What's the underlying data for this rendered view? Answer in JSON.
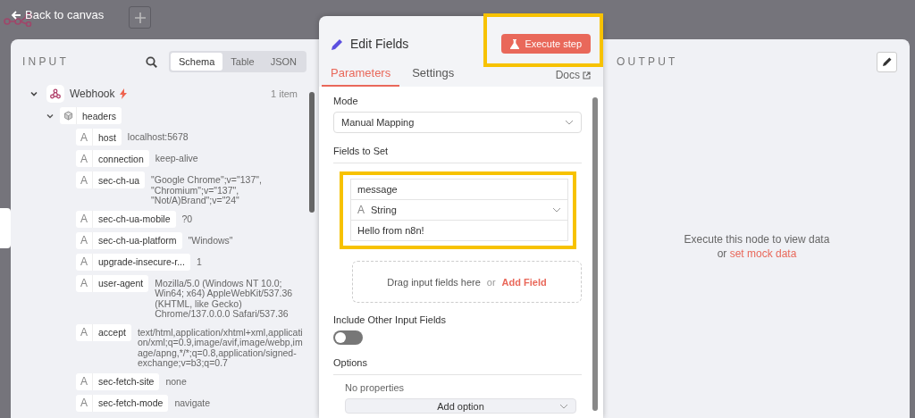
{
  "top_bar": {
    "back_label": "Back to canvas"
  },
  "input": {
    "title": "INPUT",
    "view_tabs": [
      {
        "label": "Schema",
        "selected": true
      },
      {
        "label": "Table",
        "selected": false
      },
      {
        "label": "JSON",
        "selected": false
      }
    ],
    "node": {
      "name": "Webhook",
      "count": "1 item",
      "expanded": true,
      "children": [
        {
          "name": "headers",
          "expanded": true,
          "children": [
            {
              "type_icon": "A",
              "name": "host",
              "value": "localhost:5678"
            },
            {
              "type_icon": "A",
              "name": "connection",
              "value": "keep-alive"
            },
            {
              "type_icon": "A",
              "name": "sec-ch-ua",
              "value": "\"Google Chrome\";v=\"137\", \"Chromium\";v=\"137\", \"Not/A)Brand\";v=\"24\""
            },
            {
              "type_icon": "A",
              "name": "sec-ch-ua-mobile",
              "value": "?0"
            },
            {
              "type_icon": "A",
              "name": "sec-ch-ua-platform",
              "value": "\"Windows\""
            },
            {
              "type_icon": "A",
              "name": "upgrade-insecure-r...",
              "value": "1"
            },
            {
              "type_icon": "A",
              "name": "user-agent",
              "value": "Mozilla/5.0 (Windows NT 10.0; Win64; x64) AppleWebKit/537.36 (KHTML, like Gecko) Chrome/137.0.0.0 Safari/537.36"
            },
            {
              "type_icon": "A",
              "name": "accept",
              "value": "text/html,application/xhtml+xml,application/xml;q=0.9,image/avif,image/webp,image/apng,*/*;q=0.8,application/signed-exchange;v=b3;q=0.7"
            },
            {
              "type_icon": "A",
              "name": "sec-fetch-site",
              "value": "none"
            },
            {
              "type_icon": "A",
              "name": "sec-fetch-mode",
              "value": "navigate"
            }
          ]
        }
      ]
    }
  },
  "editor": {
    "title": "Edit Fields",
    "execute_button": {
      "label": "Execute step",
      "highlighted": true
    },
    "tabs": [
      {
        "label": "Parameters",
        "selected": true
      },
      {
        "label": "Settings",
        "selected": false
      }
    ],
    "docs_label": "Docs",
    "mode": {
      "label": "Mode",
      "value": "Manual Mapping"
    },
    "fields_label": "Fields to Set",
    "assignment": {
      "name": "message",
      "type_icon": "A",
      "type": "String",
      "value": "Hello from n8n!",
      "highlighted": true
    },
    "dropzone": {
      "text": "Drag input fields here",
      "or": "or",
      "link": "Add Field"
    },
    "include_other": {
      "label": "Include Other Input Fields",
      "on": false
    },
    "options": {
      "label": "Options",
      "empty": "No properties",
      "add_label": "Add option"
    }
  },
  "output": {
    "title": "OUTPUT",
    "message": "Execute this node to view data",
    "or": "or",
    "link": "set mock data"
  }
}
